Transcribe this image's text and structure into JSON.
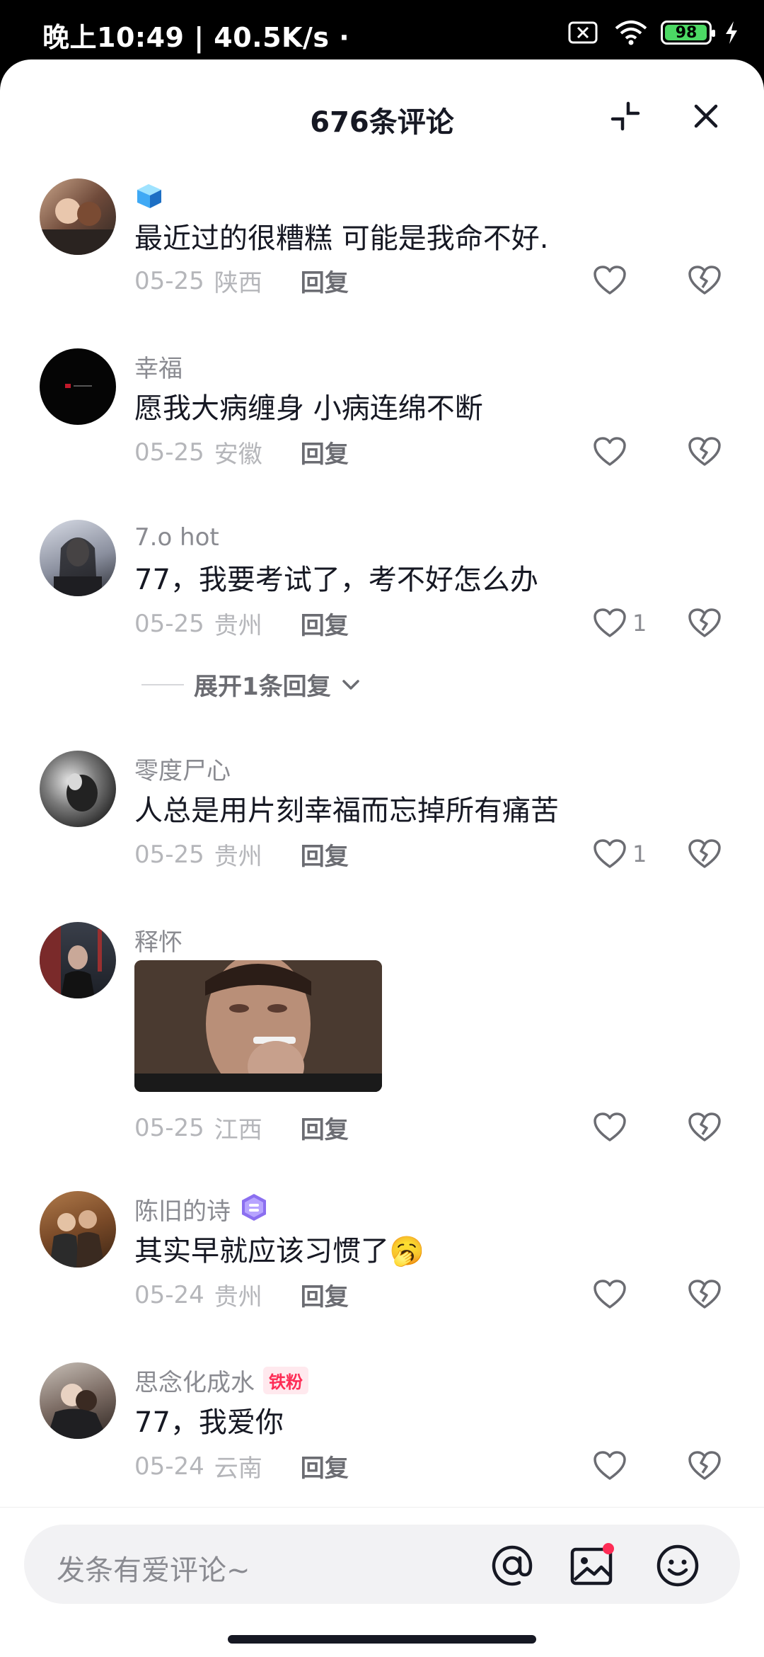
{
  "status_bar": {
    "time_speed": "晚上10:49 | 40.5K/s ·",
    "battery": "98",
    "battery_level": 0.98
  },
  "sheet": {
    "title": "676条评论"
  },
  "comments": [
    {
      "username": "",
      "text": "最近过的很糟糕 可能是我命不好.",
      "date": "05-25",
      "location": "陕西",
      "reply": "回复",
      "likes": ""
    },
    {
      "username": "幸福",
      "text": "愿我大病缠身 小病连绵不断",
      "date": "05-25",
      "location": "安徽",
      "reply": "回复",
      "likes": ""
    },
    {
      "username": "7.o hot",
      "text": "77，我要考试了，考不好怎么办",
      "date": "05-25",
      "location": "贵州",
      "reply": "回复",
      "likes": "1",
      "expand_label": "展开1条回复"
    },
    {
      "username": "零度尸心",
      "text": "人总是用片刻幸福而忘掉所有痛苦",
      "date": "05-25",
      "location": "贵州",
      "reply": "回复",
      "likes": "1"
    },
    {
      "username": "释怀",
      "text": "",
      "date": "05-25",
      "location": "江西",
      "reply": "回复",
      "likes": ""
    },
    {
      "username": "陈旧的诗",
      "text": "其实早就应该习惯了🥱",
      "date": "05-24",
      "location": "贵州",
      "reply": "回复",
      "likes": ""
    },
    {
      "username": "思念化成水",
      "badge": "铁粉",
      "text": "77，我爱你",
      "date": "05-24",
      "location": "云南",
      "reply": "回复",
      "likes": ""
    }
  ],
  "bottom_bar": {
    "placeholder": "发条有爱评论~"
  },
  "icons": {
    "at": "at-icon",
    "image": "image-icon",
    "emoji": "emoji-icon",
    "close": "close-icon",
    "collapse": "collapse-icon",
    "like": "heart-icon",
    "dislike": "broken-heart-icon"
  }
}
